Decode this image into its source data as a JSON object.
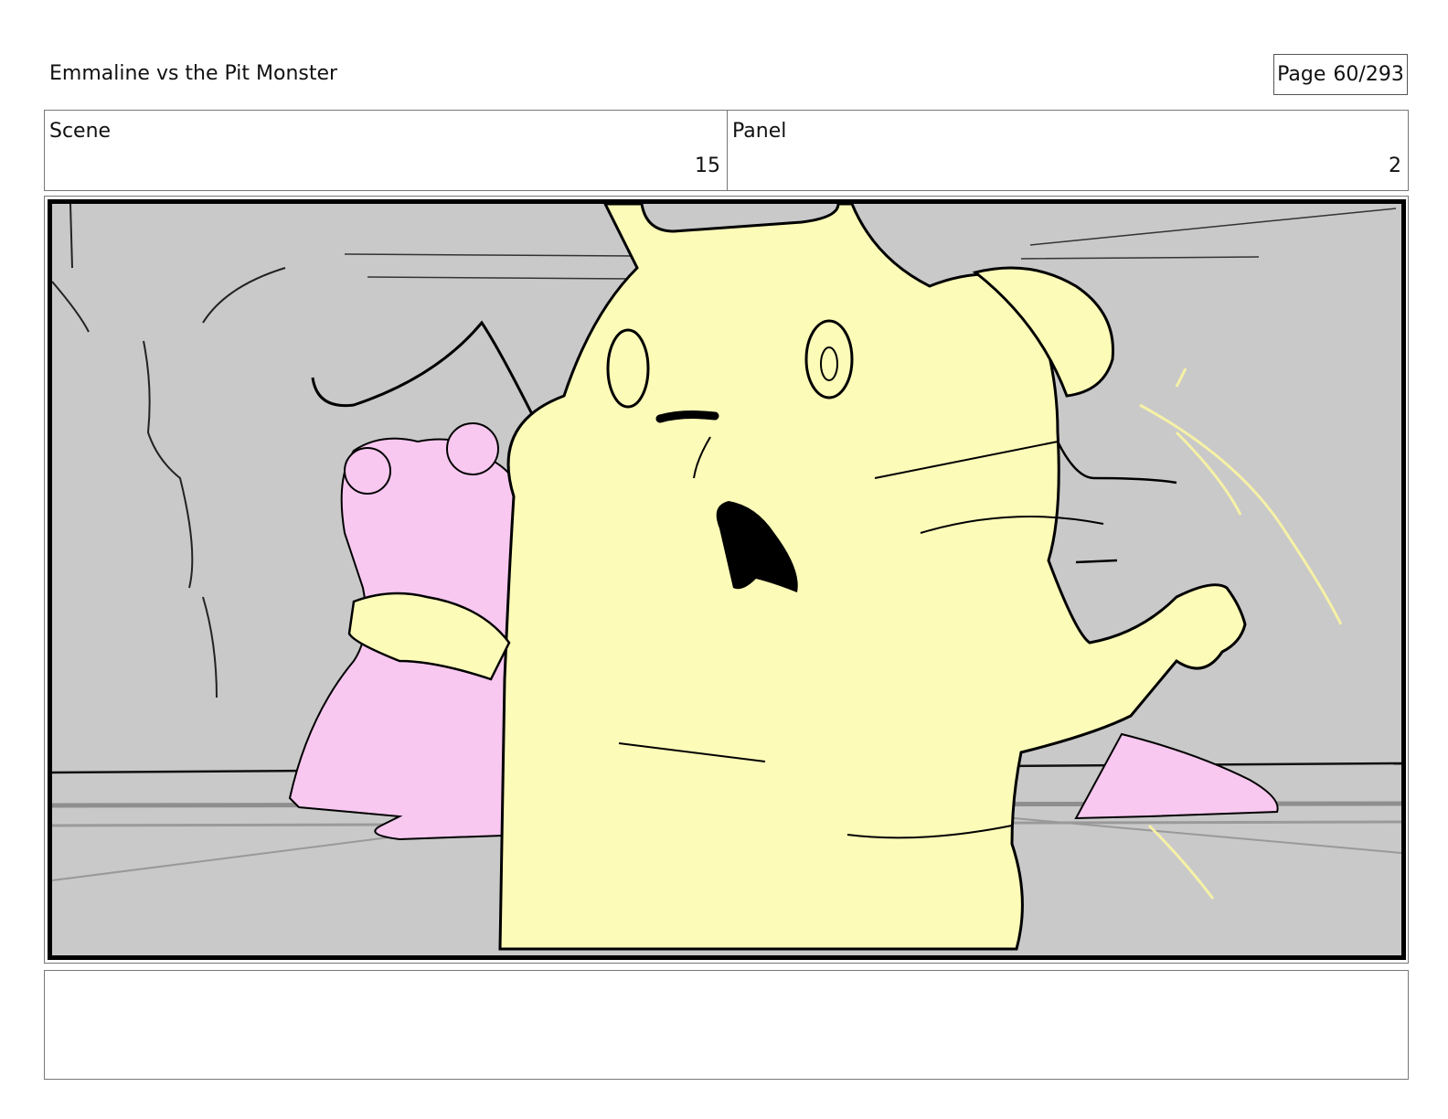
{
  "header": {
    "title": "Emmaline vs the Pit Monster",
    "page_label": "Page",
    "page_number": "60/293"
  },
  "scene": {
    "label": "Scene",
    "value": "15"
  },
  "panel": {
    "label": "Panel",
    "value": "2"
  },
  "artwork": {
    "colors": {
      "background": "#c9c9c9",
      "creature": "#fdfbb8",
      "girl": "#f8c8f0",
      "line": "#000000"
    }
  },
  "notes": {
    "text": ""
  }
}
